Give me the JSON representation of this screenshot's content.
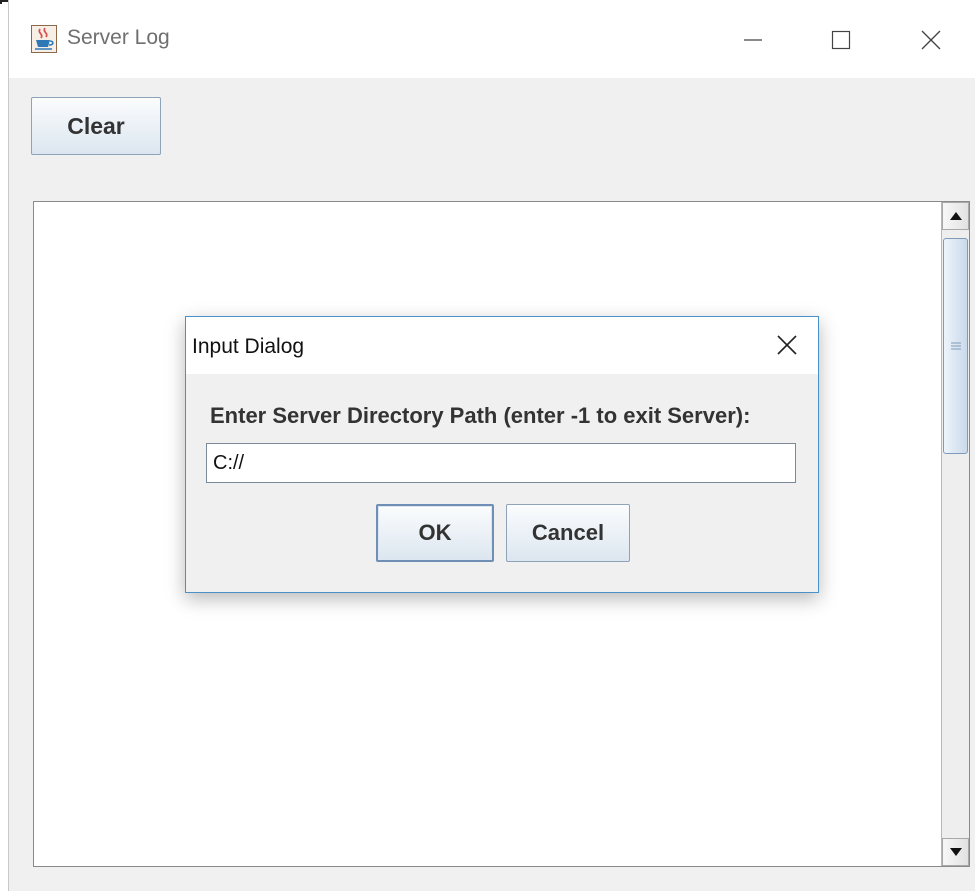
{
  "window": {
    "title": "Server Log",
    "icon": "java-coffee-cup-icon",
    "controls": [
      "minimize-icon",
      "maximize-icon",
      "close-icon"
    ]
  },
  "toolbar": {
    "clear_label": "Clear"
  },
  "log": {
    "content": ""
  },
  "dialog": {
    "title": "Input Dialog",
    "message": "Enter Server Directory Path (enter -1 to exit Server):",
    "input_value": "C://",
    "ok_label": "OK",
    "cancel_label": "Cancel"
  },
  "colors": {
    "dialog_border": "#4a90c9",
    "button_border": "#8ea2b8",
    "scroll_thumb": "#c9d9ea"
  }
}
